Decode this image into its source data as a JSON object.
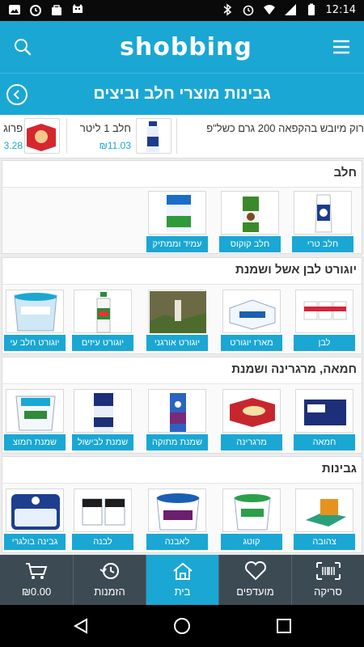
{
  "status_bar": {
    "time": "12:14"
  },
  "app": {
    "logo": "shobbing"
  },
  "title_bar": {
    "title": "גבינות מוצרי חלב וביצים"
  },
  "promo": [
    {
      "name": "רוק מיובש בהקפאה 200 גרם כשל\"פ",
      "price": ""
    },
    {
      "name": "חלב 1 ליטר",
      "price": "₪11.03"
    },
    {
      "name": "פרוג",
      "price": "3.28"
    }
  ],
  "sections": [
    {
      "title": "חלב",
      "products": [
        {
          "label": "חלב טרי"
        },
        {
          "label": "חלב קוקוס"
        },
        {
          "label": "עמיד וממתיק"
        }
      ]
    },
    {
      "title": "יוגורט לבן אשל ושמנת",
      "products": [
        {
          "label": "לבן"
        },
        {
          "label": "מארז יוגורט"
        },
        {
          "label": "יוגורט אורגני"
        },
        {
          "label": "יוגורט עיזים"
        },
        {
          "label": "יוגורט חלב עי"
        }
      ]
    },
    {
      "title": "חמאה, מרגרינה ושמנת",
      "products": [
        {
          "label": "חמאה"
        },
        {
          "label": "מרגרינה"
        },
        {
          "label": "שמנת מתוקה"
        },
        {
          "label": "שמנת לבישול"
        },
        {
          "label": "שמנת חמוצ"
        }
      ]
    },
    {
      "title": "גבינות",
      "products": [
        {
          "label": "צהובה"
        },
        {
          "label": "קוטג"
        },
        {
          "label": "לאבנה"
        },
        {
          "label": "לבנה"
        },
        {
          "label": "גבינה בולגרי"
        }
      ]
    }
  ],
  "tabs": [
    {
      "label": "סריקה",
      "icon": "barcode-icon"
    },
    {
      "label": "מועדפים",
      "icon": "heart-icon"
    },
    {
      "label": "בית",
      "icon": "home-icon"
    },
    {
      "label": "הזמנות",
      "icon": "history-icon"
    },
    {
      "label": "₪0.00",
      "icon": "cart-icon"
    }
  ],
  "colors": {
    "brand": "#1aa7d4",
    "tabbar": "#3c4a54"
  }
}
